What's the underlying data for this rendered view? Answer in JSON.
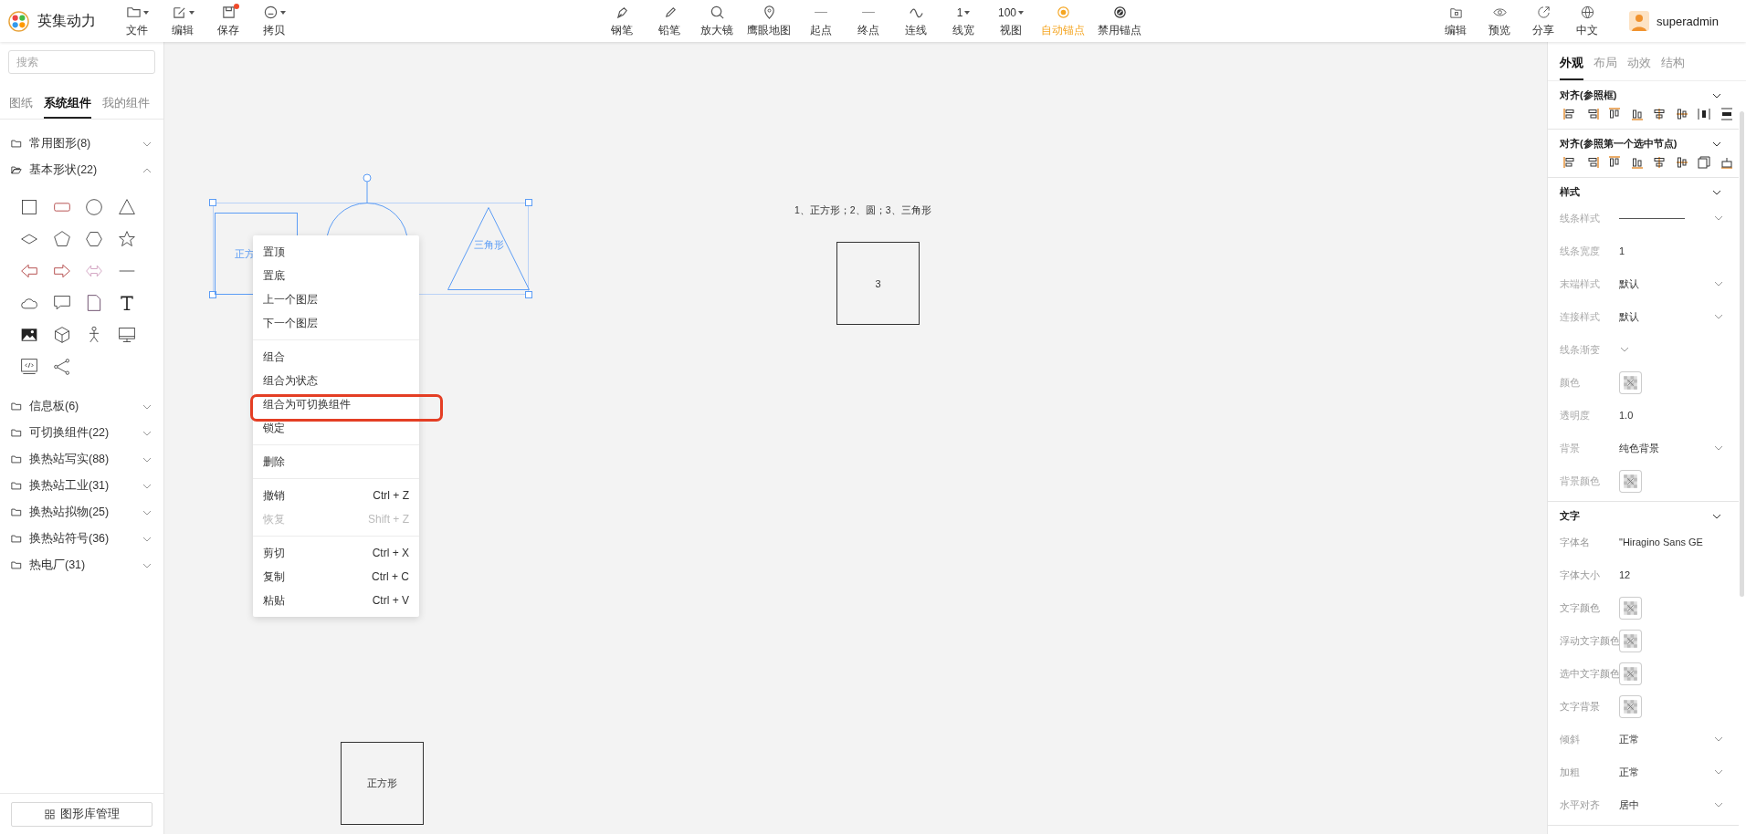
{
  "app": {
    "title": "英集动力"
  },
  "file_tools": [
    {
      "label": "文件",
      "dropdown": true,
      "badge": false
    },
    {
      "label": "编辑",
      "dropdown": true,
      "badge": false
    },
    {
      "label": "保存",
      "dropdown": false,
      "badge": true
    },
    {
      "label": "拷贝",
      "dropdown": true,
      "badge": false
    }
  ],
  "tools": [
    {
      "label": "钢笔",
      "selected": false
    },
    {
      "label": "铅笔",
      "selected": false
    },
    {
      "label": "放大镜",
      "selected": false
    },
    {
      "label": "鹰眼地图",
      "selected": false
    },
    {
      "label": "起点",
      "selected": false
    },
    {
      "label": "终点",
      "selected": false
    },
    {
      "label": "连线",
      "selected": false
    },
    {
      "label": "线宽",
      "value": "1",
      "selected": false
    },
    {
      "label": "视图",
      "value": "100",
      "selected": false
    },
    {
      "label": "自动锚点",
      "selected": true
    },
    {
      "label": "禁用锚点",
      "selected": false
    }
  ],
  "actions": [
    {
      "label": "编辑"
    },
    {
      "label": "预览"
    },
    {
      "label": "分享"
    },
    {
      "label": "中文"
    }
  ],
  "user": {
    "name": "superadmin"
  },
  "sidebar": {
    "search": {
      "placeholder": "搜索"
    },
    "tabs": [
      {
        "label": "图纸",
        "selected": false
      },
      {
        "label": "系统组件",
        "selected": true
      },
      {
        "label": "我的组件",
        "selected": false
      }
    ],
    "categories": [
      {
        "label": "常用图形(8)",
        "expanded": false
      },
      {
        "label": "基本形状(22)",
        "expanded": true
      },
      {
        "label": "信息板(6)",
        "expanded": false
      },
      {
        "label": "可切换组件(22)",
        "expanded": false
      },
      {
        "label": "换热站写实(88)",
        "expanded": false
      },
      {
        "label": "换热站工业(31)",
        "expanded": false
      },
      {
        "label": "换热站拟物(25)",
        "expanded": false
      },
      {
        "label": "换热站符号(36)",
        "expanded": false
      },
      {
        "label": "热电厂(31)",
        "expanded": false
      }
    ],
    "footer_button": "图形库管理"
  },
  "canvas": {
    "shapes": [
      {
        "kind": "square",
        "label": "正方",
        "selected": true
      },
      {
        "kind": "circle",
        "selected": true
      },
      {
        "kind": "triangle",
        "label": "三角形",
        "selected": true
      },
      {
        "kind": "note",
        "label": "1、正方形；2、圆；3、三角形"
      },
      {
        "kind": "square",
        "label": "3",
        "selected": false
      },
      {
        "kind": "square",
        "label": "正方形",
        "selected": false
      }
    ]
  },
  "context_menu": {
    "groups": [
      [
        {
          "label": "置顶",
          "disabled": false,
          "highlighted": false
        },
        {
          "label": "置底",
          "disabled": false,
          "highlighted": false
        },
        {
          "label": "上一个图层",
          "disabled": false,
          "highlighted": false
        },
        {
          "label": "下一个图层",
          "disabled": false,
          "highlighted": false
        }
      ],
      [
        {
          "label": "组合",
          "disabled": false,
          "highlighted": false
        },
        {
          "label": "组合为状态",
          "disabled": false,
          "highlighted": false
        },
        {
          "label": "组合为可切换组件",
          "disabled": false,
          "highlighted": true
        },
        {
          "label": "锁定",
          "disabled": false,
          "highlighted": false
        }
      ],
      [
        {
          "label": "删除",
          "disabled": false,
          "highlighted": false
        }
      ],
      [
        {
          "label": "撤销",
          "shortcut": "Ctrl + Z",
          "disabled": false,
          "highlighted": false
        },
        {
          "label": "恢复",
          "shortcut": "Shift + Z",
          "disabled": true,
          "highlighted": false
        }
      ],
      [
        {
          "label": "剪切",
          "shortcut": "Ctrl + X",
          "disabled": false,
          "highlighted": false
        },
        {
          "label": "复制",
          "shortcut": "Ctrl + C",
          "disabled": false,
          "highlighted": false
        },
        {
          "label": "粘贴",
          "shortcut": "Ctrl + V",
          "disabled": false,
          "highlighted": false
        }
      ]
    ]
  },
  "properties": {
    "tabs": [
      {
        "label": "外观",
        "selected": true
      },
      {
        "label": "布局",
        "selected": false
      },
      {
        "label": "动效",
        "selected": false
      },
      {
        "label": "结构",
        "selected": false
      }
    ],
    "sections": [
      {
        "kind": "align",
        "title": "对齐(参照框)",
        "expanded": true
      },
      {
        "kind": "align-node",
        "title": "对齐(参照第一个选中节点)",
        "expanded": true
      },
      {
        "kind": "form",
        "title": "样式",
        "expanded": true,
        "rows": [
          {
            "kind": "line",
            "label": "线条样式"
          },
          {
            "kind": "text",
            "label": "线条宽度",
            "value": "1"
          },
          {
            "kind": "select",
            "label": "末端样式",
            "value": "默认"
          },
          {
            "kind": "select",
            "label": "连接样式",
            "value": "默认"
          },
          {
            "kind": "select",
            "label": "线条渐变"
          },
          {
            "kind": "color",
            "label": "颜色"
          },
          {
            "kind": "text",
            "label": "透明度",
            "value": "1.0"
          },
          {
            "kind": "select",
            "label": "背景",
            "value": "纯色背景"
          },
          {
            "kind": "color",
            "label": "背景颜色"
          }
        ]
      },
      {
        "kind": "form",
        "title": "文字",
        "expanded": true,
        "rows": [
          {
            "kind": "text",
            "label": "字体名",
            "value": "\"Hiragino Sans GE"
          },
          {
            "kind": "text",
            "label": "字体大小",
            "value": "12"
          },
          {
            "kind": "color",
            "label": "文字颜色"
          },
          {
            "kind": "color",
            "label": "浮动文字颜色"
          },
          {
            "kind": "color",
            "label": "选中文字颜色"
          },
          {
            "kind": "color",
            "label": "文字背景"
          },
          {
            "kind": "select",
            "label": "倾斜",
            "value": "正常"
          },
          {
            "kind": "select",
            "label": "加粗",
            "value": "正常"
          },
          {
            "kind": "select",
            "label": "水平对齐",
            "value": "居中"
          }
        ]
      }
    ]
  }
}
